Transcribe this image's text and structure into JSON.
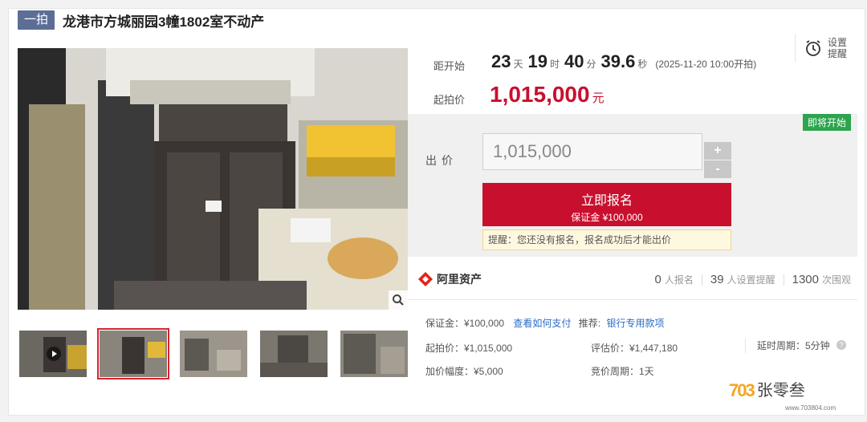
{
  "header": {
    "tag": "一拍",
    "title": "龙港市方城丽园3幢1802室不动产"
  },
  "gallery": {
    "thumbnail_count": 5,
    "active_index": 1
  },
  "countdown": {
    "label": "距开始",
    "days": "23",
    "days_unit": "天",
    "hours": "19",
    "hours_unit": "时",
    "minutes": "40",
    "minutes_unit": "分",
    "seconds": "39.6",
    "seconds_unit": "秒",
    "start_time": "(2025-11-20 10:00开拍)"
  },
  "reminder": {
    "label": "设置提醒"
  },
  "start_price": {
    "label": "起拍价",
    "value": "1,015,000",
    "unit": "元"
  },
  "bid": {
    "badge": "即将开始",
    "label": "出价",
    "input_value": "1,015,000",
    "plus": "+",
    "minus": "-",
    "signup_label": "立即报名",
    "deposit_label": "保证金 ¥100,000",
    "notice": "提醒：您还没有报名，报名成功后才能出价"
  },
  "platform": {
    "name": "阿里资产",
    "signups_count": "0",
    "signups_label": "人报名",
    "reminders_count": "39",
    "reminders_label": "人设置提醒",
    "views_count": "1300",
    "views_label": "次围观"
  },
  "details": {
    "deposit": "保证金：¥100,000",
    "pay_link": "查看如何支付",
    "recommend_label": "推荐:",
    "recommend_link": "银行专用款项",
    "start_price": "起拍价：¥1,015,000",
    "appraisal": "评估价：¥1,447,180",
    "delay_period": "延时周期：5分钟",
    "increment": "加价幅度：¥5,000",
    "bid_period": "竞价周期：1天"
  },
  "watermark": {
    "logo": "703",
    "name": "张零叁",
    "url": "www.703804.com"
  },
  "colors": {
    "accent_red": "#c8102e",
    "tag_blue": "#5c6e96",
    "badge_green": "#2da44e",
    "link_blue": "#2b6cc4"
  }
}
